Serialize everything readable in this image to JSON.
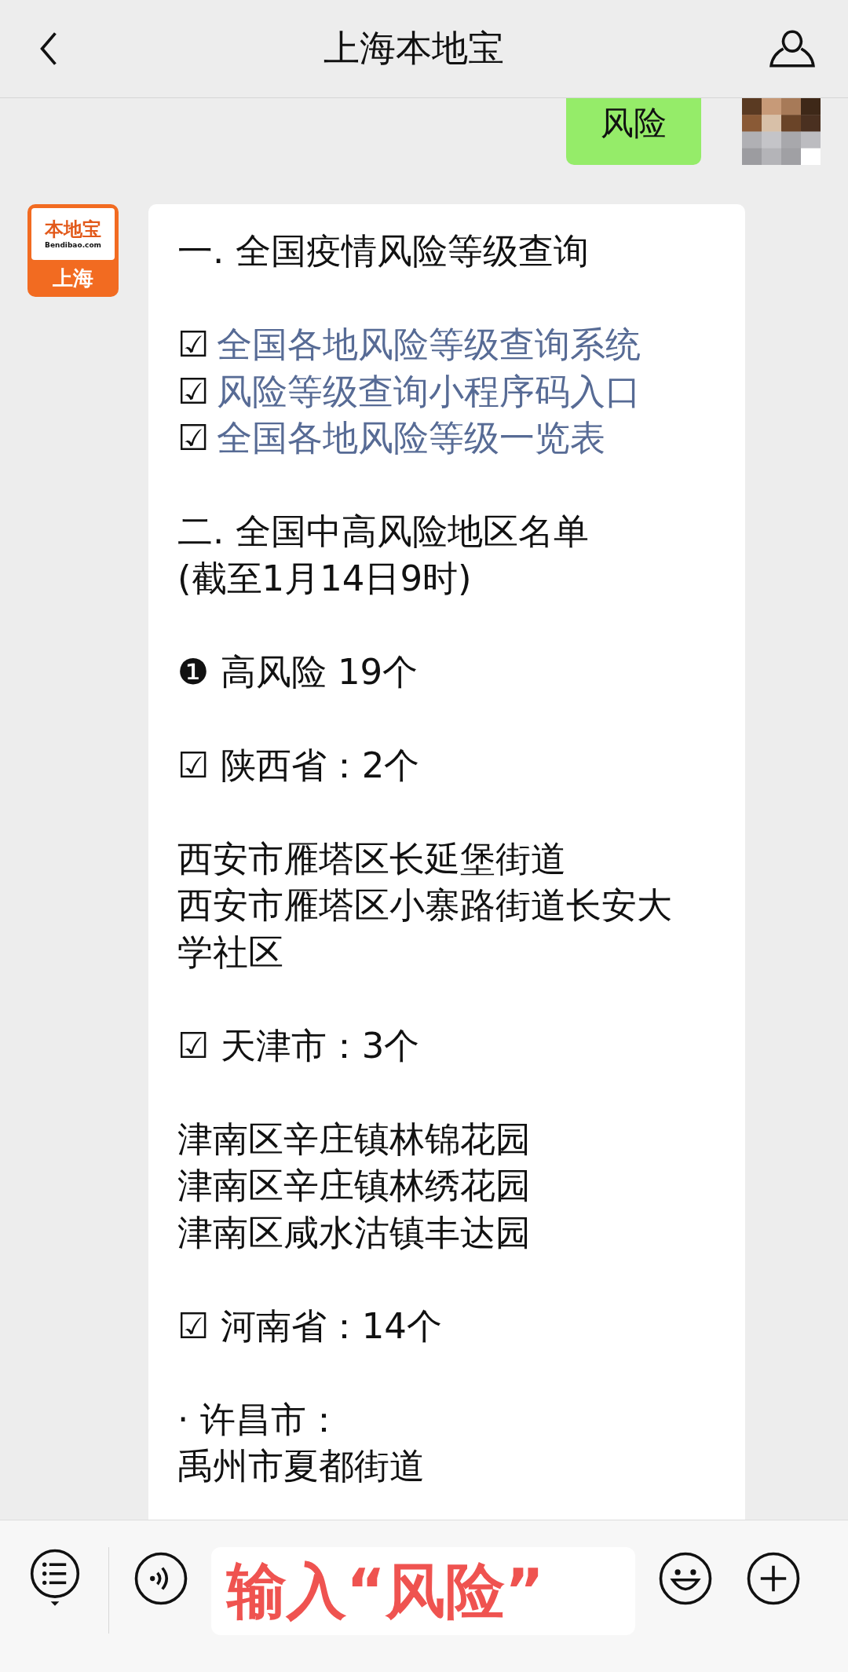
{
  "header": {
    "title": "上海本地宝"
  },
  "messages": [
    {
      "kind": "sent",
      "text": "风险"
    },
    {
      "kind": "received",
      "avatar": {
        "top": "本地宝",
        "sub": "Bendibao.com",
        "bottom": "上海"
      },
      "lines": [
        {
          "kind": "text",
          "text": "一. 全国疫情风险等级查询"
        },
        {
          "kind": "gap"
        },
        {
          "kind": "link",
          "mark": "☑",
          "text": "全国各地风险等级查询系统"
        },
        {
          "kind": "link",
          "mark": "☑",
          "text": "风险等级查询小程序码入口"
        },
        {
          "kind": "link",
          "mark": "☑",
          "text": "全国各地风险等级一览表"
        },
        {
          "kind": "gap"
        },
        {
          "kind": "text",
          "text": "二. 全国中高风险地区名单"
        },
        {
          "kind": "text",
          "text": "(截至1月14日9时)"
        },
        {
          "kind": "gap"
        },
        {
          "kind": "text",
          "text": "❶ 高风险 19个"
        },
        {
          "kind": "gap"
        },
        {
          "kind": "text",
          "text": "☑ 陕西省：2个"
        },
        {
          "kind": "gap"
        },
        {
          "kind": "text",
          "text": "西安市雁塔区长延堡街道"
        },
        {
          "kind": "text",
          "text": "西安市雁塔区小寨路街道长安大学社区"
        },
        {
          "kind": "gap"
        },
        {
          "kind": "text",
          "text": "☑ 天津市：3个"
        },
        {
          "kind": "gap"
        },
        {
          "kind": "text",
          "text": "津南区辛庄镇林锦花园"
        },
        {
          "kind": "text",
          "text": "津南区辛庄镇林绣花园"
        },
        {
          "kind": "text",
          "text": "津南区咸水沽镇丰达园"
        },
        {
          "kind": "gap"
        },
        {
          "kind": "text",
          "text": "☑ 河南省：14个"
        },
        {
          "kind": "gap"
        },
        {
          "kind": "text",
          "text": "· 许昌市："
        },
        {
          "kind": "text",
          "text": "禹州市夏都街道"
        }
      ]
    }
  ],
  "input": {
    "value": "输入“风险”"
  }
}
